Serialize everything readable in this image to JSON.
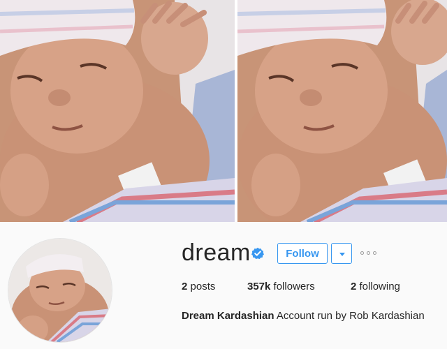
{
  "profile": {
    "username": "dream",
    "follow_label": "Follow",
    "stats": {
      "posts_count": "2",
      "posts_label": "posts",
      "followers_count": "357k",
      "followers_label": "followers",
      "following_count": "2",
      "following_label": "following"
    },
    "bio_name": "Dream Kardashian",
    "bio_text": "Account run by Rob Kardashian"
  },
  "icons": {
    "verified": "verified-badge-icon",
    "dropdown": "chevron-down-icon",
    "more": "more-options-icon"
  },
  "colors": {
    "accent": "#3897f0",
    "text": "#262626",
    "background": "#fafafa"
  }
}
